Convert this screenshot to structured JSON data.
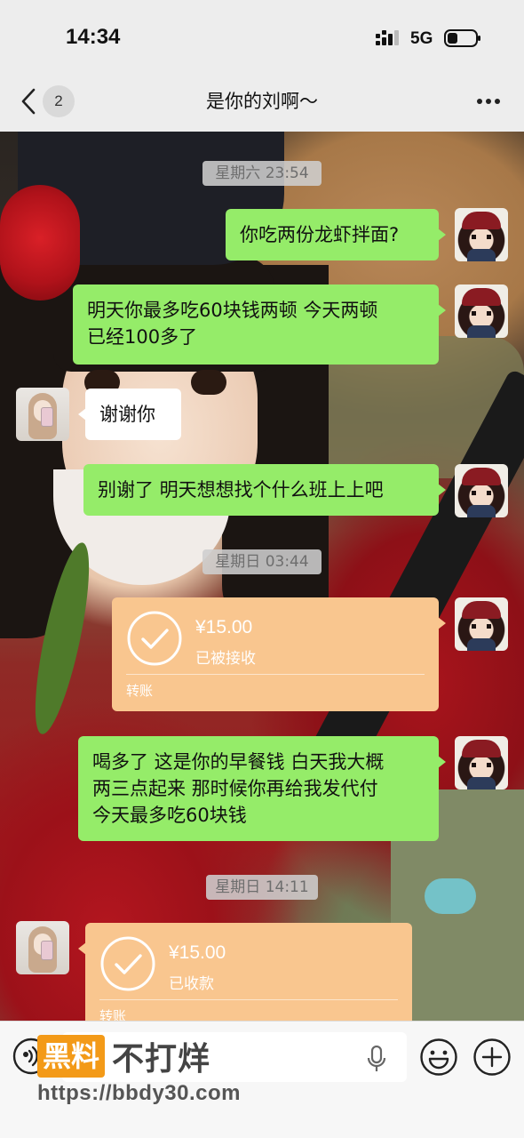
{
  "status_bar": {
    "time": "14:34",
    "network": "5G"
  },
  "nav": {
    "unread_count": "2",
    "title": "是你的刘啊～"
  },
  "chat": {
    "timestamps": [
      "星期六 23:54",
      "星期日 03:44",
      "星期日 14:11"
    ],
    "messages": [
      {
        "from": "me",
        "text": "你吃两份龙虾拌面?"
      },
      {
        "from": "me",
        "text": "明天你最多吃60块钱两顿 今天两顿\n已经100多了"
      },
      {
        "from": "other",
        "text": "谢谢你"
      },
      {
        "from": "me",
        "text": "别谢了 明天想想找个什么班上上吧"
      },
      {
        "from": "me",
        "text": "喝多了 这是你的早餐钱 白天我大概\n两三点起来 那时候你再给我发代付\n今天最多吃60块钱"
      }
    ],
    "transfers": [
      {
        "from": "me",
        "amount": "¥15.00",
        "status": "已被接收",
        "label": "转账"
      },
      {
        "from": "other",
        "amount": "¥15.00",
        "status": "已收款",
        "label": "转账"
      }
    ]
  },
  "watermark": {
    "badge": "黑料",
    "text": "不打烊",
    "url": "https://bbdy30.com"
  },
  "colors": {
    "outgoing_bubble": "#95ec69",
    "incoming_bubble": "#ffffff",
    "transfer_card": "#f9c68f",
    "watermark_badge": "#f39a18"
  }
}
